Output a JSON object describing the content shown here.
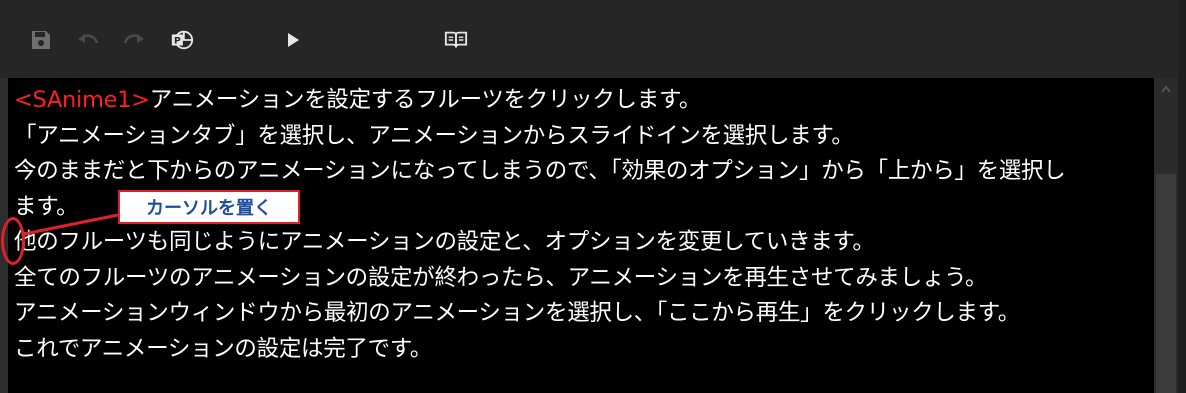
{
  "toolbar": {
    "buttons": [
      {
        "name": "save-icon"
      },
      {
        "name": "undo-icon"
      },
      {
        "name": "redo-icon"
      },
      {
        "name": "powerpoint-icon"
      },
      {
        "name": "play-icon"
      },
      {
        "name": "book-icon"
      }
    ]
  },
  "editor": {
    "line1_tag": "<SAnime1>",
    "line1_text": "アニメーションを設定するフルーツをクリックします。",
    "line2": "「アニメーションタブ」を選択し、アニメーションからスライドインを選択します。",
    "line3": "今のままだと下からのアニメーションになってしまうので、「効果のオプション」から「上から」を選択し",
    "line4": "ます。",
    "line5": "他のフルーツも同じようにアニメーションの設定と、オプションを変更していきます。",
    "line6": "全てのフルーツのアニメーションの設定が終わったら、アニメーションを再生させてみましょう。",
    "line7": "アニメーションウィンドウから最初のアニメーションを選択し、「ここから再生」をクリックします。",
    "line8": "これでアニメーションの設定は完了です。"
  },
  "annotation": {
    "callout_label": "カーソルを置く"
  },
  "colors": {
    "tag": "#ff1f1f",
    "annotation_red": "#e0212b",
    "annotation_text": "#1f4e9c"
  }
}
